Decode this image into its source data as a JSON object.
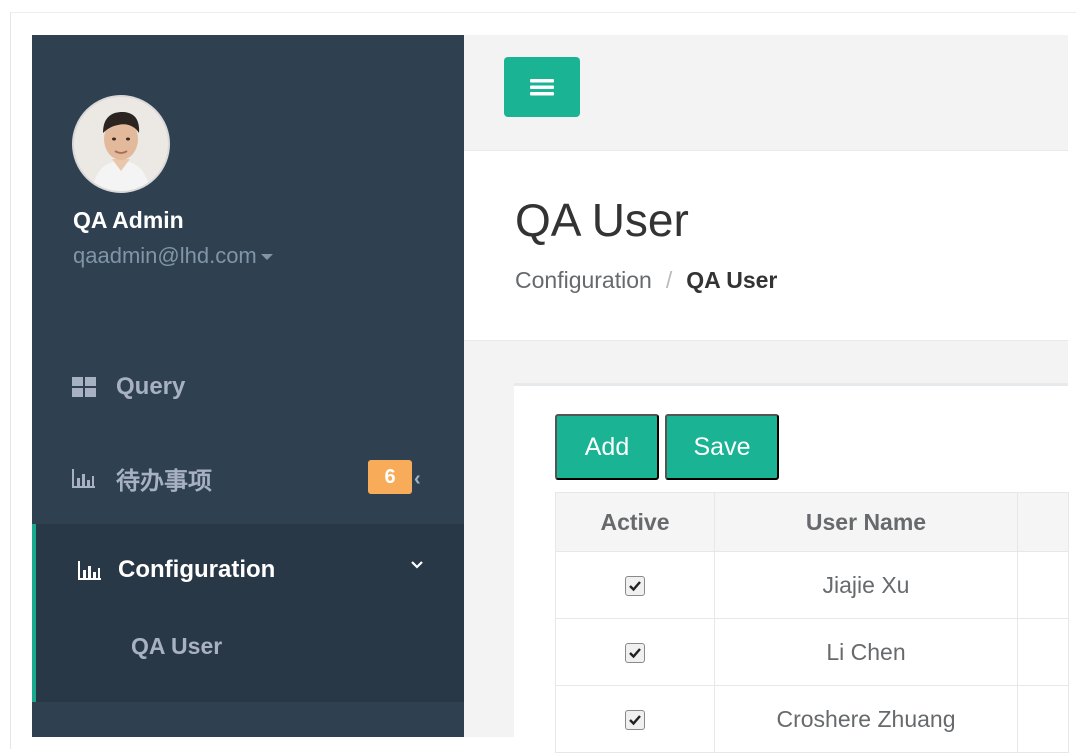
{
  "profile": {
    "name": "QA Admin",
    "email": "qaadmin@lhd.com"
  },
  "sidebar": {
    "items": [
      {
        "label": "Query",
        "icon": "grid-icon"
      },
      {
        "label": "待办事项",
        "icon": "bar-chart-icon",
        "badge": "6"
      },
      {
        "label": "Configuration",
        "icon": "bar-chart-icon",
        "expanded": true,
        "children": [
          {
            "label": "QA User"
          }
        ]
      }
    ]
  },
  "header": {
    "title": "QA User",
    "breadcrumb": {
      "parent": "Configuration",
      "separator": "/",
      "current": "QA User"
    }
  },
  "toolbar": {
    "add_label": "Add",
    "save_label": "Save"
  },
  "table": {
    "columns": [
      "Active",
      "User Name"
    ],
    "rows": [
      {
        "active": true,
        "user_name": "Jiajie Xu"
      },
      {
        "active": true,
        "user_name": "Li Chen"
      },
      {
        "active": true,
        "user_name": "Croshere Zhuang"
      }
    ]
  },
  "colors": {
    "sidebar_bg": "#2f4050",
    "accent": "#1ab394",
    "badge": "#f8ac59"
  }
}
